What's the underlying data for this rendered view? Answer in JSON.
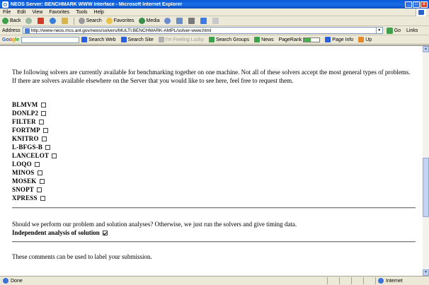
{
  "window": {
    "title": "NEOS Server: BENCHMARK WWW Interface - Microsoft Internet Explorer",
    "minimize": "_",
    "maximize": "□",
    "close": "x"
  },
  "menu": [
    "File",
    "Edit",
    "View",
    "Favorites",
    "Tools",
    "Help"
  ],
  "toolbar": {
    "back": "Back",
    "search": "Search",
    "favorites": "Favorites",
    "media": "Media"
  },
  "address": {
    "label": "Address",
    "url": "http://www-neos.mcs.anl.gov/neos/solvers/MULTI:BENCHMARK-AMPL/solver-www.html",
    "go": "Go",
    "links": "Links"
  },
  "googlebar": {
    "logo_parts": [
      "Go",
      "o",
      "g",
      "le"
    ],
    "search_web": "Search Web",
    "search_site": "Search Site",
    "feeling_lucky": "I'm Feeling Lucky",
    "search_groups": "Search Groups",
    "news": "News",
    "pagerank": "PageRank",
    "page_info": "Page Info",
    "up": "Up"
  },
  "content": {
    "intro": "The following solvers are currently available for benchmarking together on one machine. Not all of these solvers accept the most general types of problems. If there are solvers available elsewhere on the Server that you would like to see here, feel free to request them.",
    "solvers": [
      {
        "name": "BLMVM",
        "checked": false
      },
      {
        "name": "DONLP2",
        "checked": false
      },
      {
        "name": "FILTER",
        "checked": false
      },
      {
        "name": "FORTMP",
        "checked": false
      },
      {
        "name": "KNITRO",
        "checked": false
      },
      {
        "name": "L-BFGS-B",
        "checked": false
      },
      {
        "name": "LANCELOT",
        "checked": false
      },
      {
        "name": "LOQO",
        "checked": false
      },
      {
        "name": "MINOS",
        "checked": false
      },
      {
        "name": "MOSEK",
        "checked": false
      },
      {
        "name": "SNOPT",
        "checked": false
      },
      {
        "name": "XPRESS",
        "checked": false
      }
    ],
    "analysis_question": "Should we perform our problem and solution analyses? Otherwise, we just run the solvers and give timing data.",
    "independent_label": "Independent analysis of solution",
    "independent_checked": true,
    "comments_text": "These comments can be used to label your submission."
  },
  "status": {
    "text": "Done",
    "zone": "Internet"
  }
}
